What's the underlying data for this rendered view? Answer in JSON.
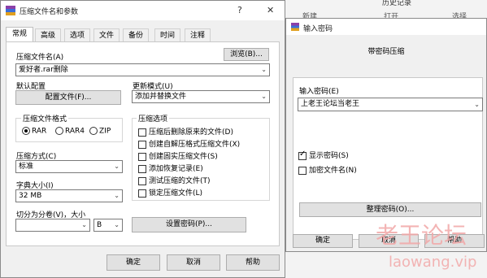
{
  "bg": {
    "history_label": "历史记录",
    "col_new": "新建",
    "col_open": "打开",
    "col_select": "选择"
  },
  "main_dialog": {
    "title": "压缩文件名和参数",
    "help_glyph": "?",
    "close_glyph": "✕",
    "tabs": [
      "常规",
      "高级",
      "选项",
      "文件",
      "备份",
      "时间",
      "注释"
    ],
    "archive_name_label": "压缩文件名(A)",
    "browse_button": "浏览(B)...",
    "archive_name_value": "爱好者.rar删除",
    "default_profile_label": "默认配置",
    "profile_button": "配置文件(F)...",
    "update_mode_label": "更新模式(U)",
    "update_mode_value": "添加并替换文件",
    "format_group_label": "压缩文件格式",
    "formats": [
      "RAR",
      "RAR4",
      "ZIP"
    ],
    "selected_format": "RAR",
    "options_group_label": "压缩选项",
    "options": [
      {
        "label": "压缩后删除原来的文件(D)",
        "checked": false
      },
      {
        "label": "创建自解压格式压缩文件(X)",
        "checked": false
      },
      {
        "label": "创建固实压缩文件(S)",
        "checked": false
      },
      {
        "label": "添加恢复记录(E)",
        "checked": false
      },
      {
        "label": "测试压缩的文件(T)",
        "checked": false
      },
      {
        "label": "锁定压缩文件(L)",
        "checked": false
      }
    ],
    "method_label": "压缩方式(C)",
    "method_value": "标准",
    "dict_label": "字典大小(I)",
    "dict_value": "32 MB",
    "split_label": "切分为分卷(V)，大小",
    "split_value": "",
    "split_unit": "B",
    "set_password_button": "设置密码(P)...",
    "ok_button": "确定",
    "cancel_button": "取消",
    "help_button": "帮助"
  },
  "password_dialog": {
    "title": "输入密码",
    "heading": "带密码压缩",
    "enter_label": "输入密码(E)",
    "password_value": "上老王论坛当老王",
    "show_password_label": "显示密码(S)",
    "show_password_checked": true,
    "encrypt_names_label": "加密文件名(N)",
    "encrypt_names_checked": false,
    "organize_button": "整理密码(O)...",
    "ok_button": "确定",
    "cancel_button": "取消",
    "help_button": "帮助"
  },
  "watermark": {
    "line1": "老王论坛",
    "line2": "laowang.vip"
  },
  "colors": {
    "watermark": "#f2a8a8",
    "window_bg": "#f0f0f0",
    "title_bg": "#ffffff"
  }
}
